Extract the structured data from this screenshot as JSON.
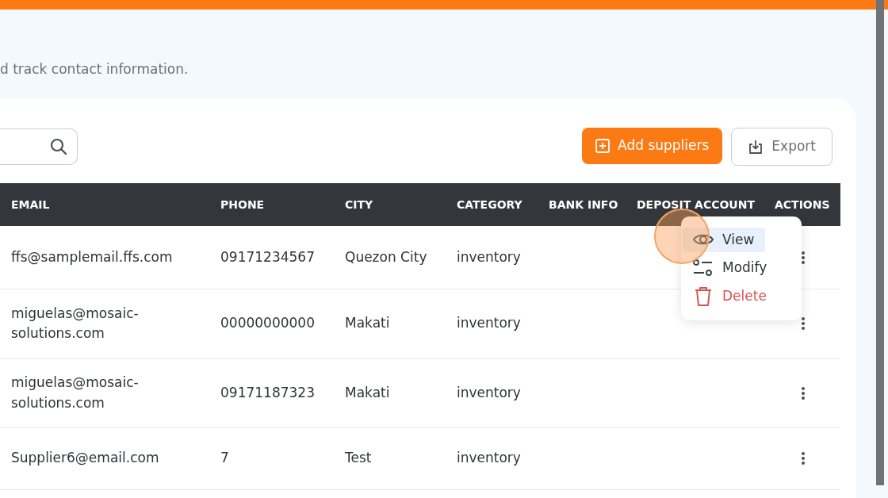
{
  "header": {
    "subtitle": "d track contact information."
  },
  "toolbar": {
    "buttons": [
      {
        "label": "Add suppliers",
        "kind": "primary"
      },
      {
        "label": "Export",
        "kind": "outline"
      }
    ]
  },
  "table": {
    "columns": [
      "EMAIL",
      "PHONE",
      "CITY",
      "CATEGORY",
      "BANK INFO",
      "DEPOSIT ACCOUNT",
      "ACTIONS"
    ],
    "rows": [
      {
        "email": "ffs@samplemail.ffs.com",
        "phone": "09171234567",
        "city": "Quezon City",
        "category": "inventory",
        "menu_open": true
      },
      {
        "email": "miguelas@mosaic-solutions.com",
        "phone": "00000000000",
        "city": "Makati",
        "category": "inventory",
        "menu_open": false
      },
      {
        "email": "miguelas@mosaic-solutions.com",
        "phone": "09171187323",
        "city": "Makati",
        "category": "inventory",
        "menu_open": false
      },
      {
        "email": "Supplier6@email.com",
        "phone": "7",
        "city": "Test",
        "category": "inventory",
        "menu_open": false
      }
    ]
  },
  "action_menu": {
    "items": [
      {
        "label": "View",
        "kind": "view",
        "selected": true
      },
      {
        "label": "Modify",
        "kind": "modify",
        "selected": false
      },
      {
        "label": "Delete",
        "kind": "delete",
        "selected": false
      }
    ]
  }
}
